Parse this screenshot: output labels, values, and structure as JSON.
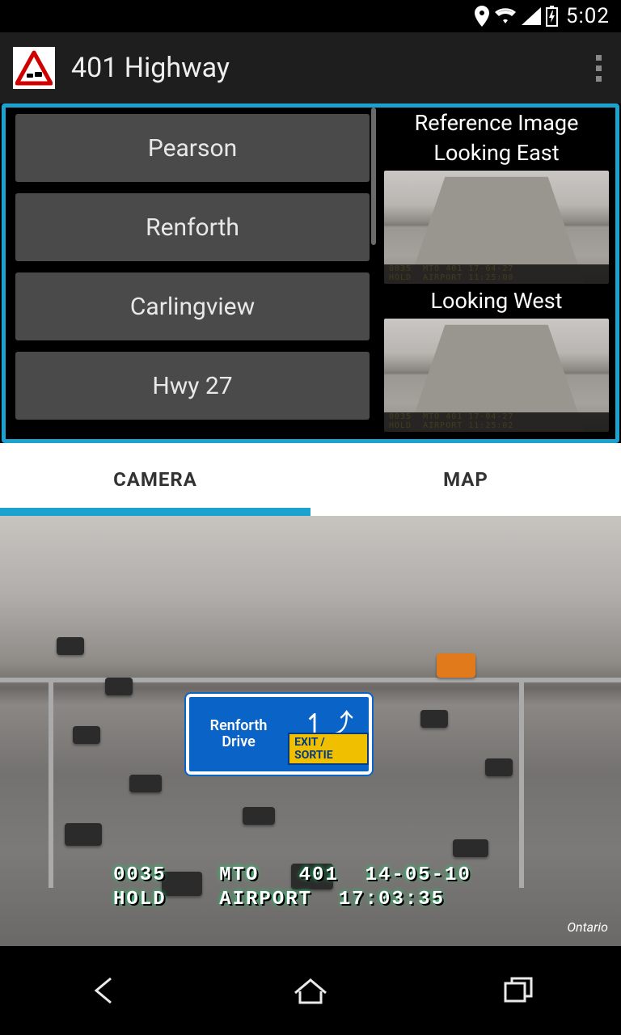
{
  "status": {
    "time": "5:02"
  },
  "appbar": {
    "title": "401 Highway"
  },
  "locations": [
    "Pearson",
    "Renforth",
    "Carlingview",
    "Hwy 27"
  ],
  "reference": {
    "header": "Reference Image",
    "east_label": "Looking East",
    "west_label": "Looking West",
    "east_stamp": "0035  MTO 401 17-04-27\nHOLD  AIRPORT 11:25:00",
    "west_stamp": "0035  MTO 401 17-04-27\nHOLD  AIRPORT 11:25:02"
  },
  "tabs": {
    "camera": "CAMERA",
    "map": "MAP",
    "active": "camera"
  },
  "camera": {
    "sign_line1": "Renforth",
    "sign_line2": "Drive",
    "sign_exit": "EXIT / SORTIE",
    "overlay": "0035    MTO   401  14-05-10\nHOLD    AIRPORT  17:03:35",
    "watermark": "Ontario"
  }
}
